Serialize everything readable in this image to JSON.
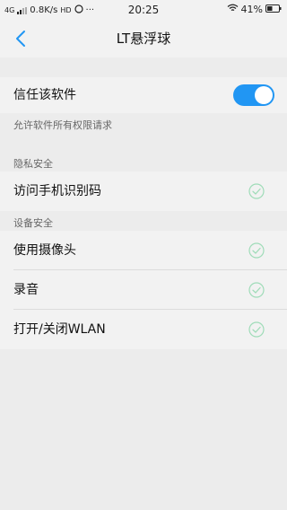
{
  "status_bar": {
    "network": "4G",
    "speed": "0.8K/s",
    "hd_badge": "HD",
    "more": "···",
    "time": "20:25",
    "battery": "41%"
  },
  "nav": {
    "back_icon": "chevron-left-icon",
    "title": "LT悬浮球"
  },
  "trust": {
    "label": "信任该软件",
    "toggle_on": true,
    "accent_color": "#2196f3",
    "hint": "允许软件所有权限请求"
  },
  "privacy": {
    "header": "隐私安全",
    "items": [
      {
        "label": "访问手机识别码",
        "checked": true
      }
    ]
  },
  "device": {
    "header": "设备安全",
    "items": [
      {
        "label": "使用摄像头",
        "checked": true
      },
      {
        "label": "录音",
        "checked": true
      },
      {
        "label": "打开/关闭WLAN",
        "checked": true
      }
    ]
  },
  "colors": {
    "check": "#9fdcb8",
    "background": "#ececec",
    "row": "#f2f2f2"
  }
}
